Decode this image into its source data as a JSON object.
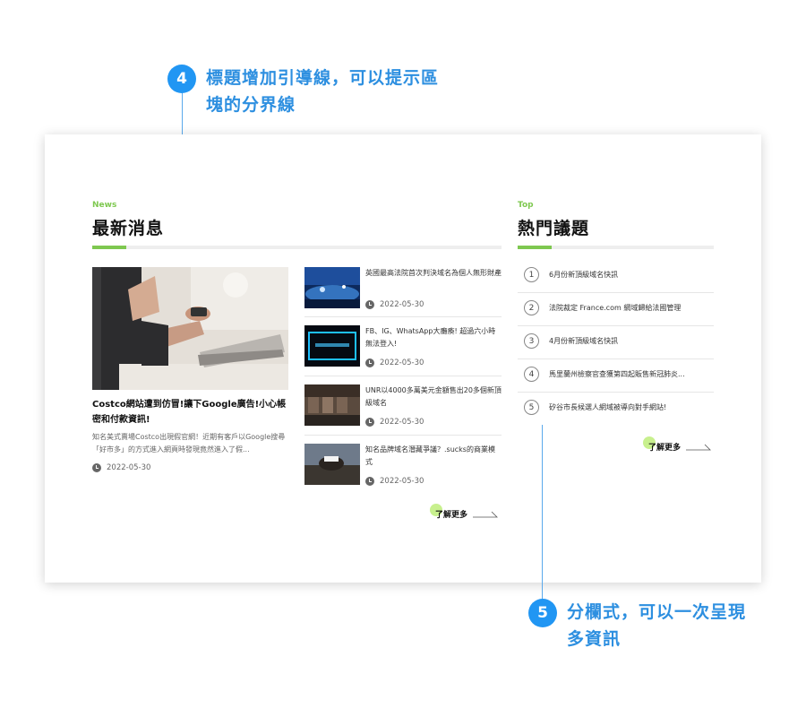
{
  "annotations": {
    "a4": {
      "number": "4",
      "line1": "標題增加引導線，可以提示區",
      "line2": "塊的分界線"
    },
    "a5": {
      "number": "5",
      "line1": "分欄式，可以一次呈現",
      "line2": "多資訊"
    }
  },
  "news": {
    "tag": "News",
    "title": "最新消息",
    "featured": {
      "title": "Costco網站遭到仿冒!讓下Google廣告!小心帳密和付款資訊!",
      "desc": "知名美式賣場Costco出現假官網！近期有客戶以Google搜尋「好市多」的方式進入網頁時發現竟然進入了假...",
      "date": "2022-05-30"
    },
    "items": [
      {
        "title": "英國最高法院首次判決域名為個人無形財產",
        "date": "2022-05-30"
      },
      {
        "title": "FB、IG、WhatsApp大癱瘓! 超過六小時無法登入!",
        "date": "2022-05-30"
      },
      {
        "title": "UNR以4000多萬美元金額售出20多個新頂級域名",
        "date": "2022-05-30"
      },
      {
        "title": "知名品牌域名潛藏爭議？.sucks的商業模式",
        "date": "2022-05-30"
      }
    ],
    "more": "了解更多"
  },
  "hot": {
    "tag": "Top",
    "title": "熱門議題",
    "items": [
      {
        "num": "1",
        "title": "6月份新頂級域名快訊"
      },
      {
        "num": "2",
        "title": "法院裁定 France.com 網域歸給法國管理"
      },
      {
        "num": "3",
        "title": "4月份新頂級域名快訊"
      },
      {
        "num": "4",
        "title": "馬里蘭州檢察官查獲第四起販售新冠肺炎..."
      },
      {
        "num": "5",
        "title": "矽谷市長候選人網域被導向對手網站!"
      }
    ],
    "more": "了解更多"
  },
  "colors": {
    "accent_green": "#7ec850",
    "callout_blue": "#2196f3",
    "more_dot": "#c8f08e"
  }
}
